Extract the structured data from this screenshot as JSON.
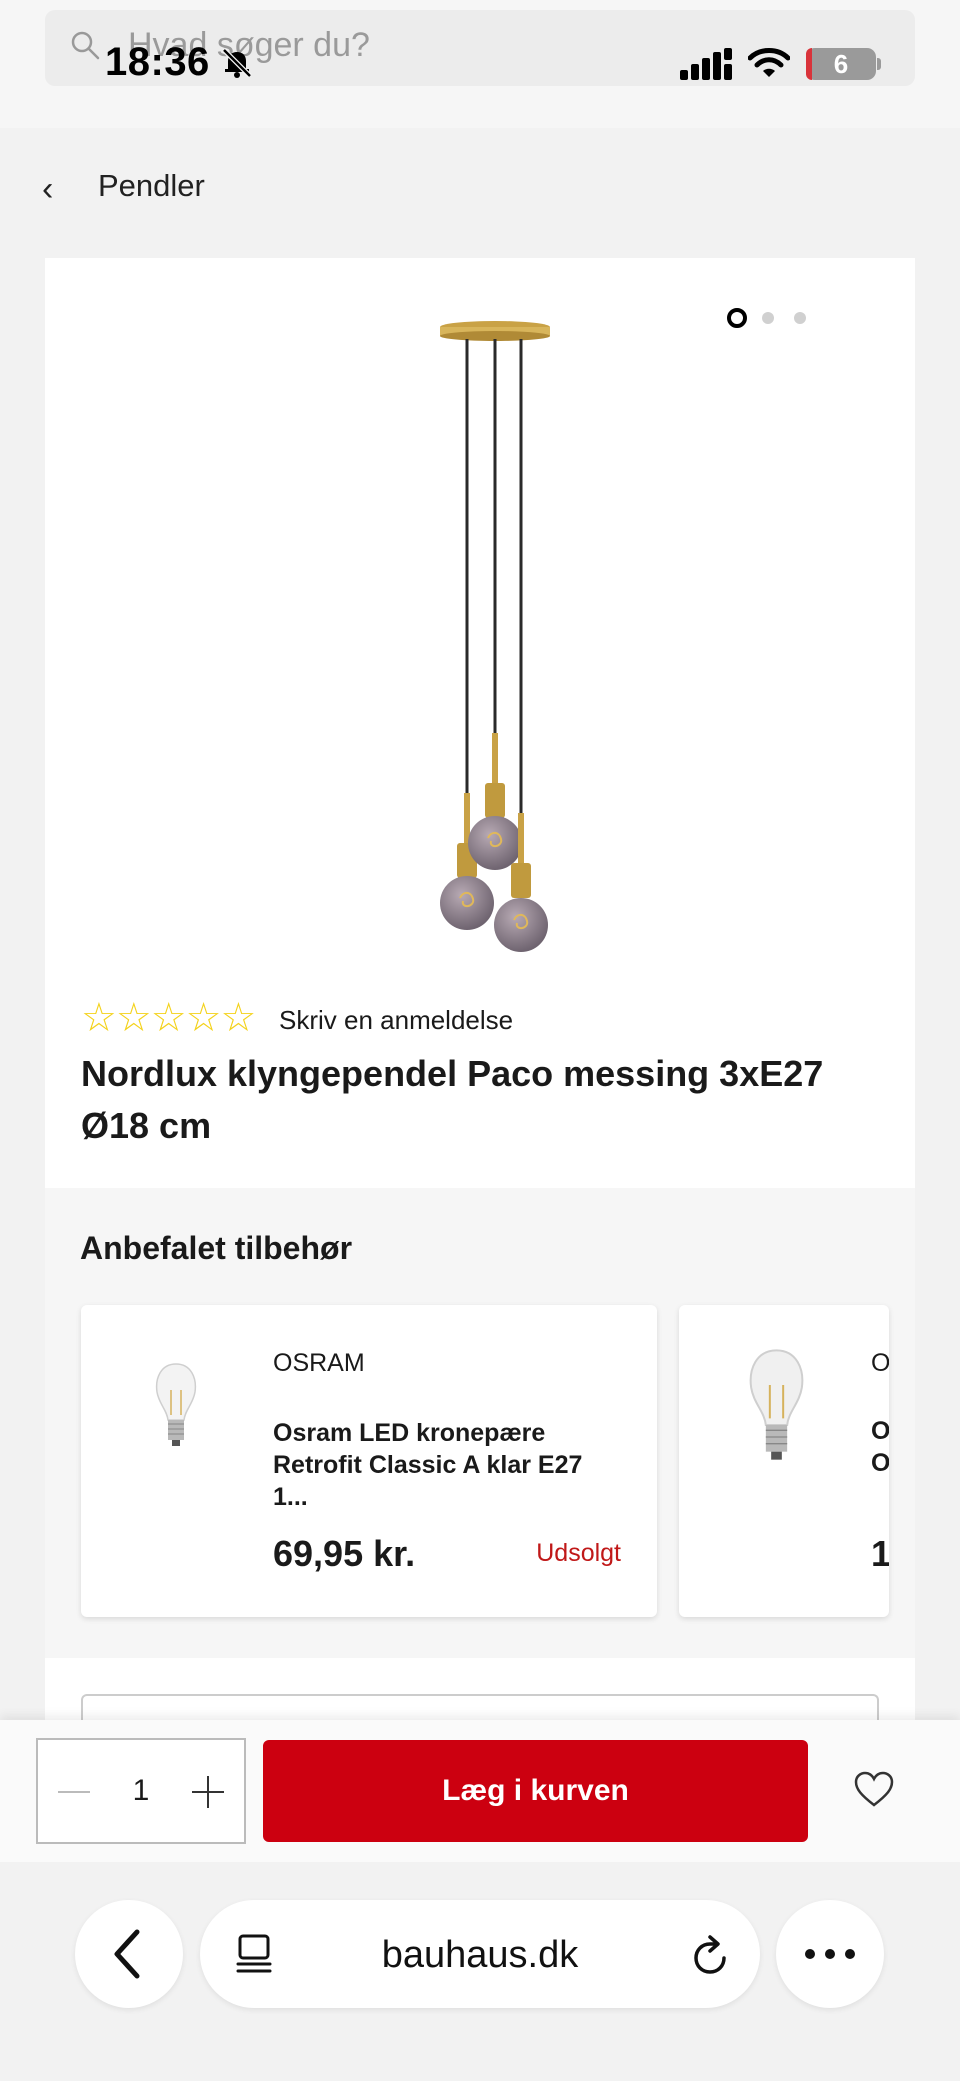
{
  "search": {
    "placeholder": "Hvad søger du?"
  },
  "status_bar": {
    "time": "18:36",
    "battery": "6"
  },
  "breadcrumb": {
    "back_icon": "chevron-left-icon",
    "label": "Pendler"
  },
  "product": {
    "review_link": "Skriv en anmeldelse",
    "rating_stars": 0,
    "rating_max": 5,
    "title": "Nordlux klyngependel Paco messing 3xE27 Ø18 cm",
    "gallery_page": 1,
    "gallery_pages": 3
  },
  "accessories": {
    "title": "Anbefalet tilbehør",
    "items": [
      {
        "brand": "OSRAM",
        "name": "Osram LED kronepære Retrofit Classic A klar E27 1...",
        "price": "69,95 kr.",
        "status": "Udsolgt"
      },
      {
        "brand": "O",
        "name": "O\nO",
        "price": "1"
      }
    ]
  },
  "cart": {
    "quantity": "1",
    "add_label": "Læg i kurven"
  },
  "browser": {
    "url": "bauhaus.dk"
  },
  "colors": {
    "brand_red": "#cc0010",
    "star_yellow": "#f4d21a",
    "sold_out": "#c01818"
  }
}
